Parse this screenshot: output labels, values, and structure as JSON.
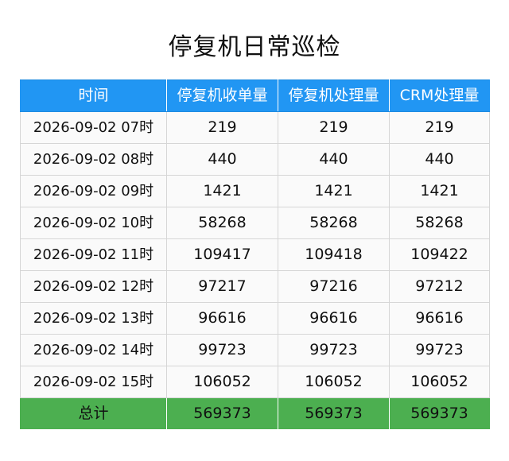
{
  "title": "停复机日常巡检",
  "table": {
    "headers": [
      "时间",
      "停复机收单量",
      "停复机处理量",
      "CRM处理量"
    ],
    "rows": [
      [
        "2026-09-02 07时",
        "219",
        "219",
        "219"
      ],
      [
        "2026-09-02 08时",
        "440",
        "440",
        "440"
      ],
      [
        "2026-09-02 09时",
        "1421",
        "1421",
        "1421"
      ],
      [
        "2026-09-02 10时",
        "58268",
        "58268",
        "58268"
      ],
      [
        "2026-09-02 11时",
        "109417",
        "109418",
        "109422"
      ],
      [
        "2026-09-02 12时",
        "97217",
        "97216",
        "97212"
      ],
      [
        "2026-09-02 13时",
        "96616",
        "96616",
        "96616"
      ],
      [
        "2026-09-02 14时",
        "99723",
        "99723",
        "99723"
      ],
      [
        "2026-09-02 15时",
        "106052",
        "106052",
        "106052"
      ]
    ],
    "footer": [
      "总计",
      "569373",
      "569373",
      "569373"
    ]
  },
  "colors": {
    "header_bg": "#2196f3",
    "header_text": "#ffffff",
    "row_bg": "#fafafa",
    "footer_bg": "#4caf50"
  }
}
